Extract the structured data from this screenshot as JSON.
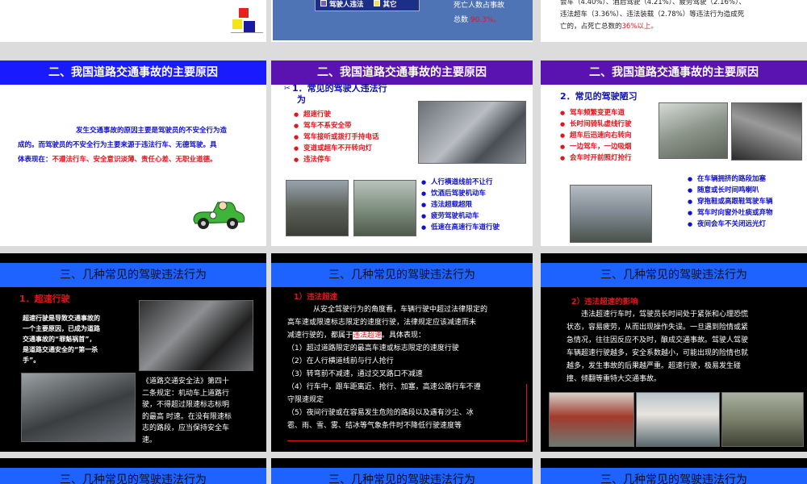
{
  "row0": {
    "mid": {
      "legend_1": "驾驶人违法",
      "legend_2": "其它",
      "stat_line1": "死亡人数占事故",
      "stat_prefix": "总数",
      "stat_value": "90.3%。"
    },
    "right": {
      "line1": "会车（4.40%）、酒后驾驶（4.21%）、疲劳驾驶（2.16%）、",
      "line2": "违法超车（3.36%）、违法装载（2.78%）等违法行为造成死",
      "line3_prefix": "亡的，占死亡总数的",
      "line3_value": "36%以上。"
    }
  },
  "row1": {
    "left": {
      "title": "二、我国道路交通事故的主要原因",
      "para1": "发生交通事故的原因主要是驾驶员的不安全行为造",
      "para2": "成的。而驾驶员的不安全行为主要来源于违法行车、无德驾驶。具",
      "para3_prefix": "体表现在：",
      "para3_red": "不遵法行车、安全意识淡薄、责任心差、无职业道德。"
    },
    "mid": {
      "title": "二、我国道路交通事故的主要原因",
      "subtitle_a": "1．常见的驾驶人违法行",
      "subtitle_b": "为",
      "list1": [
        "超速行驶",
        "驾车不系安全带",
        "驾车接听或拨打手持电话",
        "变道或超车不开转向灯",
        "违法停车"
      ],
      "list2": [
        "人行横道线前不让行",
        "饮酒后驾驶机动车",
        "违法超载超限",
        "疲劳驾驶机动车",
        "低速在高速行车道行驶"
      ]
    },
    "right": {
      "title": "二、我国道路交通事故的主要原因",
      "subtitle": "2．常见的驾驶陋习",
      "list1": [
        "驾车频繁变更车道",
        "长时间骑轧虚线行驶",
        "超车后迅速向右转向",
        "一边驾车，一边吸烟",
        "会车时开前照灯抢行"
      ],
      "list2": [
        "在车辆拥挤的路段加塞",
        "随意或长时间鸣喇叭",
        "穿拖鞋或高跟鞋驾驶车辆",
        "驾车时向窗外吐痰或弃物",
        "夜间会车不关闭远光灯"
      ]
    }
  },
  "row2": {
    "left": {
      "title": "三、几种常见的驾驶违法行为",
      "heading": "1．超速行驶",
      "para": [
        "超速行驶是导致交通事故的",
        "一个主要原因，已成为道路",
        "交通事故的“罪魁祸首”，",
        "是道路交通安全的“第一杀",
        "手”。"
      ],
      "law": [
        "《道路交通安全法》第四十",
        "二条规定：机动车上道路行",
        "驶，不得超过限速标志标明",
        "的最高 时速。在没有限速标",
        "志的路段，应当保持安全车",
        "速。"
      ]
    },
    "mid": {
      "title": "三、几种常见的驾驶违法行为",
      "heading": "1）违法超速",
      "p1": "从安全驾驶行为的角度看，车辆行驶中超过法律限定的",
      "p2": "高车速或限速标志限定的速度行驶，法律规定应该减速而未",
      "p3_prefix": "减速行驶的，都属于",
      "p3_red": "违法超速",
      "p3_suffix": "。具体表现：",
      "items": [
        "（1）超过道路限定的最高车速或标志限定的速度行驶",
        "（2）在人行横道线前与行人抢行",
        "（3）转弯前不减速，通过交叉路口不减速",
        "（4）行车中，跟车距离近、抢行、加塞，高速公路行车不遵",
        "守限速规定",
        "（5）夜间行驶或在容易发生危险的路段以及遇有沙尘、冰",
        "雹、雨、雪、雾、结冰等气象条件时不降低行驶速度等"
      ]
    },
    "right": {
      "title": "三、几种常见的驾驶违法行为",
      "heading": "2）违法超速的影响",
      "para": [
        "违法超速行车时，驾驶员长时间处于紧张和心理恐慌",
        "状态，容易疲劳，从而出现操作失误。一旦遇到险情或紧",
        "急情况，往往因反应不及时，酿成交通事故。驾驶人驾驶",
        "车辆超速行驶越多，安全系数越小，可能出现的险情也就",
        "越多，发生事故的后果越严重。超速行驶，极易发生碰",
        "撞、倾翻等重特大交通事故。"
      ]
    }
  },
  "row3": {
    "left": {
      "title": "三、几种常见的驾驶违法行为"
    },
    "mid": {
      "title": "三、几种常见的驾驶违法行为"
    },
    "right": {
      "title": "三、几种常见的驾驶违法行为"
    }
  }
}
